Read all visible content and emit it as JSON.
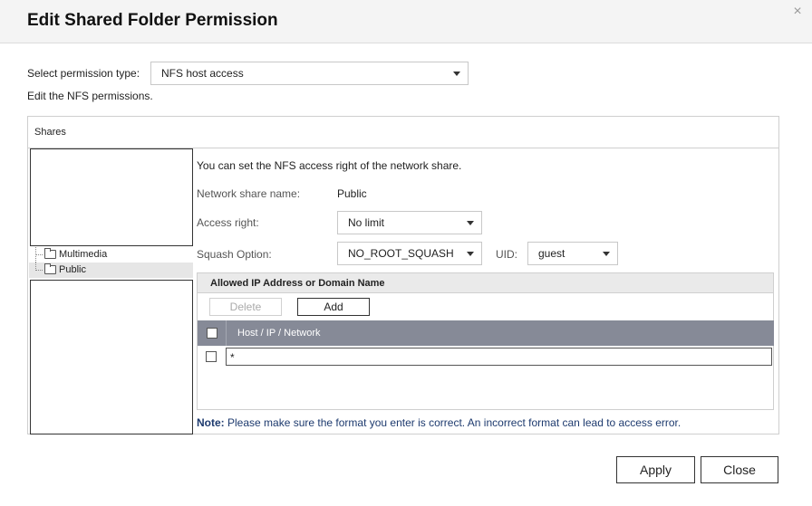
{
  "dialog": {
    "title": "Edit Shared Folder Permission",
    "close_glyph": "×"
  },
  "permission": {
    "label": "Select permission type:",
    "value": "NFS host access",
    "hint": "Edit the NFS permissions."
  },
  "shares": {
    "header": "Shares",
    "items": [
      {
        "label": "Multimedia",
        "selected": false
      },
      {
        "label": "Public",
        "selected": true
      }
    ]
  },
  "nfs": {
    "intro": "You can set the NFS access right of the network share.",
    "share_name_label": "Network share name:",
    "share_name_value": "Public",
    "access_label": "Access right:",
    "access_value": "No limit",
    "squash_label": "Squash Option:",
    "squash_value": "NO_ROOT_SQUASH",
    "uid_label": "UID:",
    "uid_value": "guest"
  },
  "allowed": {
    "header": "Allowed IP Address or Domain Name",
    "delete_label": "Delete",
    "add_label": "Add",
    "column_header": "Host / IP / Network",
    "rows": [
      {
        "value": "*"
      }
    ]
  },
  "note": {
    "prefix": "Note:",
    "text": " Please make sure the format you enter is correct. An incorrect format can lead to access error."
  },
  "footer": {
    "apply_label": "Apply",
    "close_label": "Close"
  }
}
